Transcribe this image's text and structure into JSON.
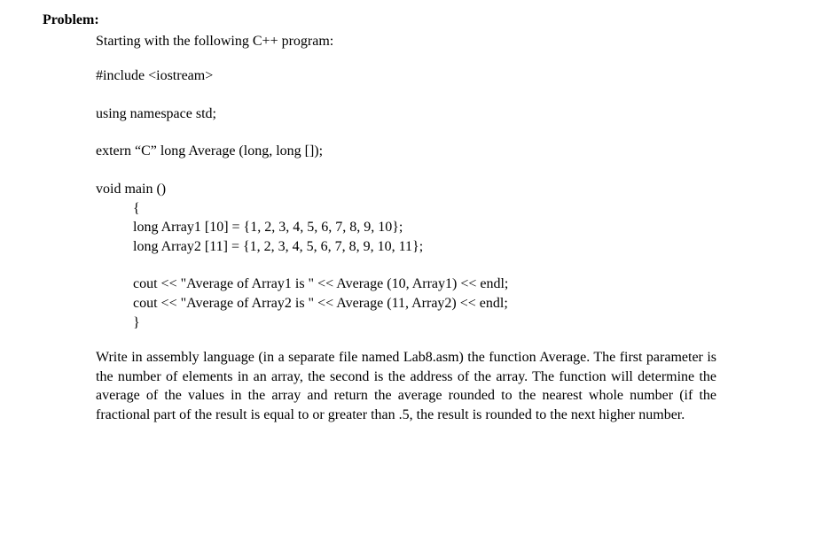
{
  "heading": "Problem:",
  "intro": "Starting with the following C++ program:",
  "code": {
    "include": "#include <iostream>",
    "using": "using namespace std;",
    "extern": "extern “C” long Average (long, long []);",
    "voidmain": "void main ()",
    "openbrace": "{",
    "arr1": "long Array1 [10] = {1, 2, 3, 4, 5, 6, 7, 8, 9, 10};",
    "arr2": "long Array2 [11] = {1, 2, 3, 4, 5, 6, 7, 8, 9, 10, 11};",
    "cout1": "cout << \"Average of Array1 is \" << Average (10, Array1) << endl;",
    "cout2": "cout << \"Average of Array2 is \" << Average (11, Array2) << endl;",
    "closebrace": "}"
  },
  "description": "Write in assembly language (in a separate file named Lab8.asm) the function Average. The first parameter is the number of elements in an array, the second is the address of the array. The function will determine the average of the values in the array and return the average rounded to the nearest whole number (if the fractional part of the result is equal to or greater than .5, the result is rounded to the next higher number."
}
